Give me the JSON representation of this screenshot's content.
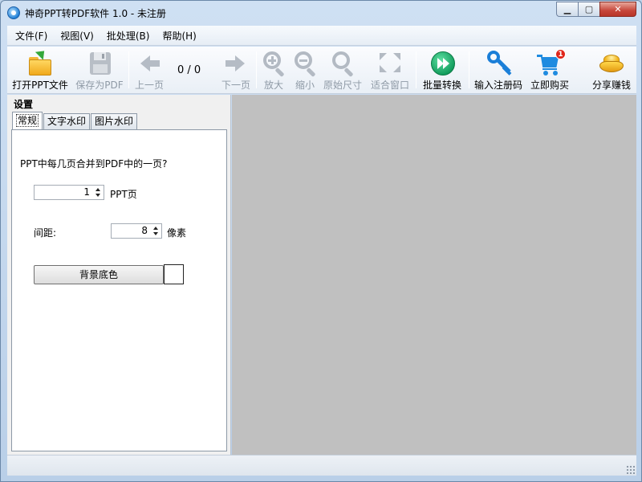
{
  "window": {
    "title": "神奇PPT转PDF软件 1.0 - 未注册",
    "controls": {
      "minimize": "▁",
      "maximize": "▢",
      "close": "✕"
    }
  },
  "menu": [
    "文件(F)",
    "视图(V)",
    "批处理(B)",
    "帮助(H)"
  ],
  "toolbar": {
    "open": "打开PPT文件",
    "save": "保存为PDF",
    "prev": "上一页",
    "page_counter": "0 / 0",
    "next": "下一页",
    "zoom_in": "放大",
    "zoom_out": "缩小",
    "original_size": "原始尺寸",
    "fit_window": "适合窗口",
    "batch": "批量转换",
    "register": "输入注册码",
    "buy": "立即购买",
    "cart_badge": "1",
    "share": "分享赚钱"
  },
  "settings": {
    "title": "设置",
    "tabs": [
      "常规",
      "文字水印",
      "图片水印"
    ],
    "question": "PPT中每几页合并到PDF中的一页?",
    "pages_value": "1",
    "pages_unit": "PPT页",
    "spacing_label": "间距:",
    "spacing_value": "8",
    "spacing_unit": "像素",
    "bg_button": "背景底色",
    "bg_color": "#ffffff"
  },
  "icons": {
    "open": "folder-open-icon",
    "save": "floppy-disk-icon",
    "prev": "arrow-left-icon",
    "next": "arrow-right-icon",
    "zoom_in": "zoom-in-icon",
    "zoom_out": "zoom-out-icon",
    "original_size": "magnifier-icon",
    "fit_window": "fit-window-icon",
    "batch": "fast-forward-icon",
    "register": "key-icon",
    "buy": "shopping-cart-icon",
    "share": "gold-ingot-icon"
  },
  "colors": {
    "preview_bg": "#c0c0c0",
    "batch_green": "#0f9a5a",
    "accent_blue": "#1b7fd8",
    "badge_red": "#e0261b"
  }
}
